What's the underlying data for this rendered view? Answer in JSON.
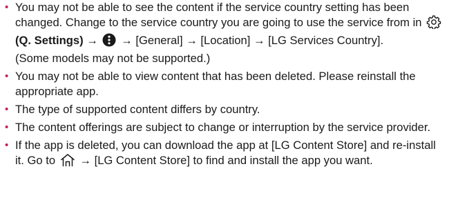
{
  "bullet_char": "•",
  "accent_color": "#c2185b",
  "items": [
    {
      "seg1": "You may not be able to see the content if the service country setting has been changed. Change to the service country you are going to use the service from in",
      "settings_label": "(Q. Settings)",
      "arrow": "→",
      "path": "[General] → [Location] → [LG Services Country]",
      "seg2": ".",
      "note": "(Some models may not be supported.)",
      "icons": [
        "gear-icon",
        "more-options-icon"
      ]
    },
    {
      "text": "You may not be able to view content that has been deleted. Please reinstall the appropriate app."
    },
    {
      "text": "The type of supported content differs by country."
    },
    {
      "text": "The content offerings are subject to change or interruption by the service provider."
    },
    {
      "seg1": "If the app is deleted, you can download the app at [LG Content Store] and re-install it. Go to",
      "arrow": "→",
      "seg2": "[LG Content Store] to find and install the app you want.",
      "icons": [
        "home-icon"
      ]
    }
  ]
}
